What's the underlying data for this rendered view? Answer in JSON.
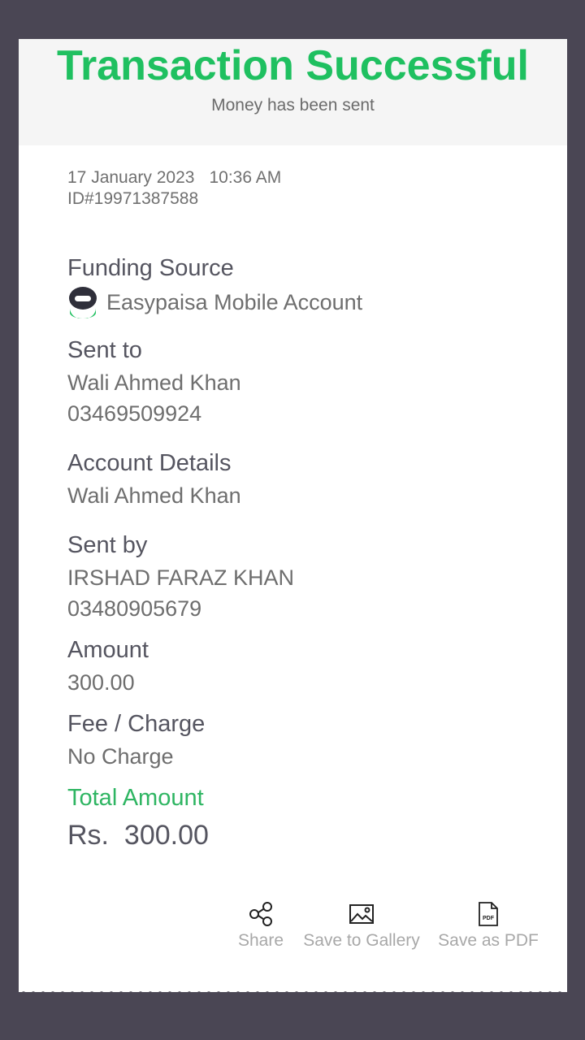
{
  "header": {
    "title": "Transaction Successful",
    "subtitle": "Money has been sent"
  },
  "meta": {
    "date": "17 January 2023",
    "time": "10:36 AM",
    "id": "ID#19971387588"
  },
  "funding": {
    "label": "Funding Source",
    "value": "Easypaisa Mobile Account",
    "icon": "easypaisa-logo-icon"
  },
  "sent_to": {
    "label": "Sent to",
    "name": "Wali Ahmed Khan",
    "number": "03469509924"
  },
  "account_details": {
    "label": "Account Details",
    "name": "Wali Ahmed Khan"
  },
  "sent_by": {
    "label": "Sent by",
    "name": "IRSHAD FARAZ KHAN",
    "number": "03480905679"
  },
  "amount": {
    "label": "Amount",
    "value": "300.00"
  },
  "fee": {
    "label": "Fee / Charge",
    "value": "No Charge"
  },
  "total": {
    "label": "Total Amount",
    "currency": "Rs.",
    "value": "300.00"
  },
  "actions": {
    "share": "Share",
    "gallery": "Save to Gallery",
    "pdf": "Save as PDF",
    "pdf_icon_text": "PDF"
  },
  "colors": {
    "accent_green": "#1fc060",
    "background": "#4a4654"
  }
}
